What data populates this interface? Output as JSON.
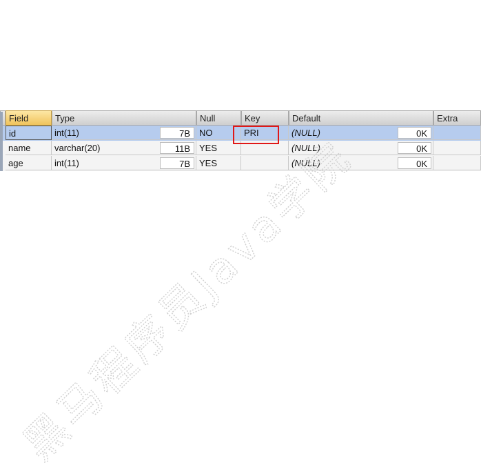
{
  "columns": {
    "field": "Field",
    "type": "Type",
    "null": "Null",
    "key": "Key",
    "default": "Default",
    "extra": "Extra"
  },
  "rows": [
    {
      "field": "id",
      "type": "int(11)",
      "size": "7B",
      "null": "NO",
      "key": "PRI",
      "default": "(NULL)",
      "default_size": "0K",
      "extra": ""
    },
    {
      "field": "name",
      "type": "varchar(20)",
      "size": "11B",
      "null": "YES",
      "key": "",
      "default": "(NULL)",
      "default_size": "0K",
      "extra": ""
    },
    {
      "field": "age",
      "type": "int(11)",
      "size": "7B",
      "null": "YES",
      "key": "",
      "default": "(NULL)",
      "default_size": "0K",
      "extra": ""
    }
  ],
  "watermark": "黑马程序员Java学院",
  "colors": {
    "selected_row": "#b6ccee",
    "highlight_box": "#e01818",
    "header_active": "#f0c35c"
  }
}
